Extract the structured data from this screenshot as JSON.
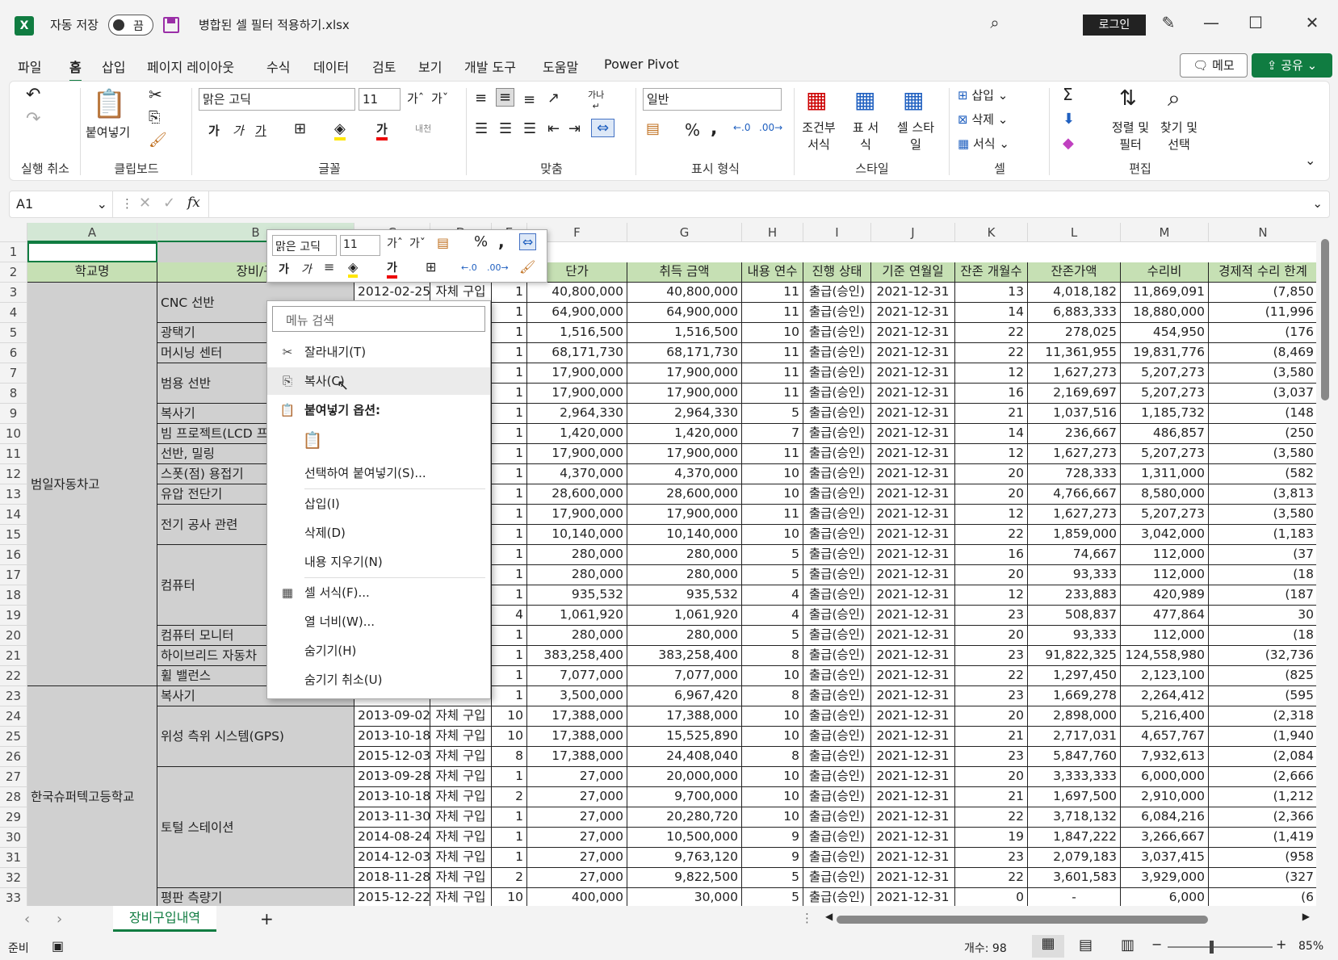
{
  "titlebar": {
    "autosave_label": "자동 저장",
    "toggle_state": "끔",
    "filename": "병합된 셀 필터 적용하기.xlsx",
    "login_label": "로그인"
  },
  "menubar": {
    "tabs": [
      "파일",
      "홈",
      "삽입",
      "페이지 레이아웃",
      "수식",
      "데이터",
      "검토",
      "보기",
      "개발 도구",
      "도움말",
      "Power Pivot"
    ],
    "active": "홈",
    "memo_label": "메모",
    "share_label": "공유"
  },
  "ribbon": {
    "undo_group": "실행 취소",
    "clipboard": {
      "paste": "붙여넣기",
      "group": "클립보드"
    },
    "font": {
      "name": "맑은 고딕",
      "size": "11",
      "group": "글꼴",
      "bold": "가",
      "italic": "가",
      "underline": "가",
      "font_color": "가"
    },
    "align": {
      "group": "맞춤",
      "wrap": "자동 줄 바꿈"
    },
    "number": {
      "format": "일반",
      "group": "표시 형식",
      "percent": "%",
      "comma": ","
    },
    "styles": {
      "cond": "조건부 서식",
      "table": "표 서식",
      "cell": "셀 스타일",
      "group": "스타일"
    },
    "cells": {
      "insert": "삽입",
      "delete": "삭제",
      "format": "서식",
      "group": "셀"
    },
    "editing": {
      "sort": "정렬 및 필터",
      "find": "찾기 및 선택",
      "group": "편집"
    }
  },
  "formula": {
    "namebox": "A1",
    "fx": "fx"
  },
  "columns": [
    "A",
    "B",
    "C",
    "D",
    "E",
    "F",
    "G",
    "H",
    "I",
    "J",
    "K",
    "L",
    "M",
    "N"
  ],
  "headers": {
    "A": "학교명",
    "B": "장비/구",
    "F": "단가",
    "G": "취득 금액",
    "H": "내용 연수",
    "I": "진행 상태",
    "J": "기준 연월일",
    "K": "잔존 개월수",
    "L": "잔존가액",
    "M": "수리비",
    "N": "경제적 수리 한계"
  },
  "rows": [
    {
      "n": 3,
      "c": "2012-02-25",
      "d": "자체 구입",
      "e": "1",
      "f": "40,800,000",
      "g": "40,800,000",
      "h": "11",
      "i": "출급(승인)",
      "j": "2021-12-31",
      "k": "13",
      "l": "4,018,182",
      "m": "11,869,091",
      "nn": "(7,850"
    },
    {
      "n": 4,
      "c": "",
      "d": "",
      "e": "1",
      "f": "64,900,000",
      "g": "64,900,000",
      "h": "11",
      "i": "출급(승인)",
      "j": "2021-12-31",
      "k": "14",
      "l": "6,883,333",
      "m": "18,880,000",
      "nn": "(11,996"
    },
    {
      "n": 5,
      "c": "",
      "d": "",
      "e": "1",
      "f": "1,516,500",
      "g": "1,516,500",
      "h": "10",
      "i": "출급(승인)",
      "j": "2021-12-31",
      "k": "22",
      "l": "278,025",
      "m": "454,950",
      "nn": "(176"
    },
    {
      "n": 6,
      "c": "",
      "d": "",
      "e": "1",
      "f": "68,171,730",
      "g": "68,171,730",
      "h": "11",
      "i": "출급(승인)",
      "j": "2021-12-31",
      "k": "22",
      "l": "11,361,955",
      "m": "19,831,776",
      "nn": "(8,469"
    },
    {
      "n": 7,
      "c": "",
      "d": "",
      "e": "1",
      "f": "17,900,000",
      "g": "17,900,000",
      "h": "11",
      "i": "출급(승인)",
      "j": "2021-12-31",
      "k": "12",
      "l": "1,627,273",
      "m": "5,207,273",
      "nn": "(3,580"
    },
    {
      "n": 8,
      "c": "",
      "d": "",
      "e": "1",
      "f": "17,900,000",
      "g": "17,900,000",
      "h": "11",
      "i": "출급(승인)",
      "j": "2021-12-31",
      "k": "16",
      "l": "2,169,697",
      "m": "5,207,273",
      "nn": "(3,037"
    },
    {
      "n": 9,
      "c": "",
      "d": "",
      "e": "1",
      "f": "2,964,330",
      "g": "2,964,330",
      "h": "5",
      "i": "출급(승인)",
      "j": "2021-12-31",
      "k": "21",
      "l": "1,037,516",
      "m": "1,185,732",
      "nn": "(148"
    },
    {
      "n": 10,
      "c": "",
      "d": "",
      "e": "1",
      "f": "1,420,000",
      "g": "1,420,000",
      "h": "7",
      "i": "출급(승인)",
      "j": "2021-12-31",
      "k": "14",
      "l": "236,667",
      "m": "486,857",
      "nn": "(250"
    },
    {
      "n": 11,
      "c": "",
      "d": "",
      "e": "1",
      "f": "17,900,000",
      "g": "17,900,000",
      "h": "11",
      "i": "출급(승인)",
      "j": "2021-12-31",
      "k": "12",
      "l": "1,627,273",
      "m": "5,207,273",
      "nn": "(3,580"
    },
    {
      "n": 12,
      "c": "",
      "d": "",
      "e": "1",
      "f": "4,370,000",
      "g": "4,370,000",
      "h": "10",
      "i": "출급(승인)",
      "j": "2021-12-31",
      "k": "20",
      "l": "728,333",
      "m": "1,311,000",
      "nn": "(582"
    },
    {
      "n": 13,
      "c": "",
      "d": "",
      "e": "1",
      "f": "28,600,000",
      "g": "28,600,000",
      "h": "10",
      "i": "출급(승인)",
      "j": "2021-12-31",
      "k": "20",
      "l": "4,766,667",
      "m": "8,580,000",
      "nn": "(3,813"
    },
    {
      "n": 14,
      "c": "",
      "d": "",
      "e": "1",
      "f": "17,900,000",
      "g": "17,900,000",
      "h": "11",
      "i": "출급(승인)",
      "j": "2021-12-31",
      "k": "12",
      "l": "1,627,273",
      "m": "5,207,273",
      "nn": "(3,580"
    },
    {
      "n": 15,
      "c": "",
      "d": "",
      "e": "1",
      "f": "10,140,000",
      "g": "10,140,000",
      "h": "10",
      "i": "출급(승인)",
      "j": "2021-12-31",
      "k": "22",
      "l": "1,859,000",
      "m": "3,042,000",
      "nn": "(1,183"
    },
    {
      "n": 16,
      "c": "",
      "d": "",
      "e": "1",
      "f": "280,000",
      "g": "280,000",
      "h": "5",
      "i": "출급(승인)",
      "j": "2021-12-31",
      "k": "16",
      "l": "74,667",
      "m": "112,000",
      "nn": "(37"
    },
    {
      "n": 17,
      "c": "",
      "d": "",
      "e": "1",
      "f": "280,000",
      "g": "280,000",
      "h": "5",
      "i": "출급(승인)",
      "j": "2021-12-31",
      "k": "20",
      "l": "93,333",
      "m": "112,000",
      "nn": "(18"
    },
    {
      "n": 18,
      "c": "",
      "d": "",
      "e": "1",
      "f": "935,532",
      "g": "935,532",
      "h": "4",
      "i": "출급(승인)",
      "j": "2021-12-31",
      "k": "12",
      "l": "233,883",
      "m": "420,989",
      "nn": "(187"
    },
    {
      "n": 19,
      "c": "",
      "d": "",
      "e": "4",
      "f": "1,061,920",
      "g": "1,061,920",
      "h": "4",
      "i": "출급(승인)",
      "j": "2021-12-31",
      "k": "23",
      "l": "508,837",
      "m": "477,864",
      "nn": "30"
    },
    {
      "n": 20,
      "c": "",
      "d": "",
      "e": "1",
      "f": "280,000",
      "g": "280,000",
      "h": "5",
      "i": "출급(승인)",
      "j": "2021-12-31",
      "k": "20",
      "l": "93,333",
      "m": "112,000",
      "nn": "(18"
    },
    {
      "n": 21,
      "c": "",
      "d": "",
      "e": "1",
      "f": "383,258,400",
      "g": "383,258,400",
      "h": "8",
      "i": "출급(승인)",
      "j": "2021-12-31",
      "k": "23",
      "l": "91,822,325",
      "m": "124,558,980",
      "nn": "(32,736"
    },
    {
      "n": 22,
      "c": "",
      "d": "",
      "e": "1",
      "f": "7,077,000",
      "g": "7,077,000",
      "h": "10",
      "i": "출급(승인)",
      "j": "2021-12-31",
      "k": "22",
      "l": "1,297,450",
      "m": "2,123,100",
      "nn": "(825"
    },
    {
      "n": 23,
      "c": "",
      "d": "",
      "e": "1",
      "f": "3,500,000",
      "g": "6,967,420",
      "h": "8",
      "i": "출급(승인)",
      "j": "2021-12-31",
      "k": "23",
      "l": "1,669,278",
      "m": "2,264,412",
      "nn": "(595"
    },
    {
      "n": 24,
      "c": "2013-09-02",
      "d": "자체 구입",
      "e": "10",
      "f": "17,388,000",
      "g": "17,388,000",
      "h": "10",
      "i": "출급(승인)",
      "j": "2021-12-31",
      "k": "20",
      "l": "2,898,000",
      "m": "5,216,400",
      "nn": "(2,318"
    },
    {
      "n": 25,
      "c": "2013-10-18",
      "d": "자체 구입",
      "e": "10",
      "f": "17,388,000",
      "g": "15,525,890",
      "h": "10",
      "i": "출급(승인)",
      "j": "2021-12-31",
      "k": "21",
      "l": "2,717,031",
      "m": "4,657,767",
      "nn": "(1,940"
    },
    {
      "n": 26,
      "c": "2015-12-03",
      "d": "자체 구입",
      "e": "8",
      "f": "17,388,000",
      "g": "24,408,040",
      "h": "8",
      "i": "출급(승인)",
      "j": "2021-12-31",
      "k": "23",
      "l": "5,847,760",
      "m": "7,932,613",
      "nn": "(2,084"
    },
    {
      "n": 27,
      "c": "2013-09-28",
      "d": "자체 구입",
      "e": "1",
      "f": "27,000",
      "g": "20,000,000",
      "h": "10",
      "i": "출급(승인)",
      "j": "2021-12-31",
      "k": "20",
      "l": "3,333,333",
      "m": "6,000,000",
      "nn": "(2,666"
    },
    {
      "n": 28,
      "c": "2013-10-18",
      "d": "자체 구입",
      "e": "2",
      "f": "27,000",
      "g": "9,700,000",
      "h": "10",
      "i": "출급(승인)",
      "j": "2021-12-31",
      "k": "21",
      "l": "1,697,500",
      "m": "2,910,000",
      "nn": "(1,212"
    },
    {
      "n": 29,
      "c": "2013-11-30",
      "d": "자체 구입",
      "e": "1",
      "f": "27,000",
      "g": "20,280,720",
      "h": "10",
      "i": "출급(승인)",
      "j": "2021-12-31",
      "k": "22",
      "l": "3,718,132",
      "m": "6,084,216",
      "nn": "(2,366"
    },
    {
      "n": 30,
      "c": "2014-08-24",
      "d": "자체 구입",
      "e": "1",
      "f": "27,000",
      "g": "10,500,000",
      "h": "9",
      "i": "출급(승인)",
      "j": "2021-12-31",
      "k": "19",
      "l": "1,847,222",
      "m": "3,266,667",
      "nn": "(1,419"
    },
    {
      "n": 31,
      "c": "2014-12-03",
      "d": "자체 구입",
      "e": "1",
      "f": "27,000",
      "g": "9,763,120",
      "h": "9",
      "i": "출급(승인)",
      "j": "2021-12-31",
      "k": "23",
      "l": "2,079,183",
      "m": "3,037,415",
      "nn": "(958"
    },
    {
      "n": 32,
      "c": "2018-11-28",
      "d": "자체 구입",
      "e": "2",
      "f": "27,000",
      "g": "9,822,500",
      "h": "5",
      "i": "출급(승인)",
      "j": "2021-12-31",
      "k": "22",
      "l": "3,601,583",
      "m": "3,929,000",
      "nn": "(327"
    },
    {
      "n": 33,
      "c": "2015-12-22",
      "d": "자체 구입",
      "e": "10",
      "f": "400,000",
      "g": "30,000",
      "h": "5",
      "i": "출급(승인)",
      "j": "2021-12-31",
      "k": "0",
      "l": "-",
      "m": "6,000",
      "nn": "(6"
    }
  ],
  "school_a": "범일자동차고",
  "school_b": "한국슈퍼텍고등학교",
  "equipment": [
    {
      "label": "CNC 선반",
      "r0": 3,
      "r1": 4
    },
    {
      "label": "광택기",
      "r0": 5,
      "r1": 5
    },
    {
      "label": "머시닝 센터",
      "r0": 6,
      "r1": 6
    },
    {
      "label": "범용 선반",
      "r0": 7,
      "r1": 8
    },
    {
      "label": "복사기",
      "r0": 9,
      "r1": 9
    },
    {
      "label": "빔 프로젝트(LCD 프",
      "r0": 10,
      "r1": 10
    },
    {
      "label": "선반, 밀링",
      "r0": 11,
      "r1": 11
    },
    {
      "label": "스폿(점) 용접기",
      "r0": 12,
      "r1": 12
    },
    {
      "label": "유압 전단기",
      "r0": 13,
      "r1": 13
    },
    {
      "label": "전기 공사 관련",
      "r0": 14,
      "r1": 15
    },
    {
      "label": "컴퓨터",
      "r0": 16,
      "r1": 19
    },
    {
      "label": "컴퓨터 모니터",
      "r0": 20,
      "r1": 20
    },
    {
      "label": "하이브리드 자동차",
      "r0": 21,
      "r1": 21
    },
    {
      "label": "휠 밸런스",
      "r0": 22,
      "r1": 22
    },
    {
      "label": "복사기",
      "r0": 23,
      "r1": 23
    },
    {
      "label": "위성 측위 시스템(GPS)",
      "r0": 24,
      "r1": 26
    },
    {
      "label": "토털 스테이션",
      "r0": 27,
      "r1": 32
    },
    {
      "label": "평판 측량기",
      "r0": 33,
      "r1": 33
    }
  ],
  "minitoolbar": {
    "font": "맑은 고딕",
    "size": "11",
    "percent": "%",
    "comma": ","
  },
  "context_menu": {
    "search_placeholder": "메뉴 검색",
    "cut": "잘라내기(T)",
    "copy": "복사(C)",
    "paste_options": "붙여넣기 옵션:",
    "paste_special": "선택하여 붙여넣기(S)...",
    "insert": "삽입(I)",
    "delete": "삭제(D)",
    "clear": "내용 지우기(N)",
    "format_cells": "셀 서식(F)...",
    "col_width": "열 너비(W)...",
    "hide": "숨기기(H)",
    "unhide": "숨기기 취소(U)"
  },
  "sheet": {
    "tab": "장비구입내역"
  },
  "status": {
    "ready": "준비",
    "count": "개수: 98",
    "zoom": "85%"
  }
}
